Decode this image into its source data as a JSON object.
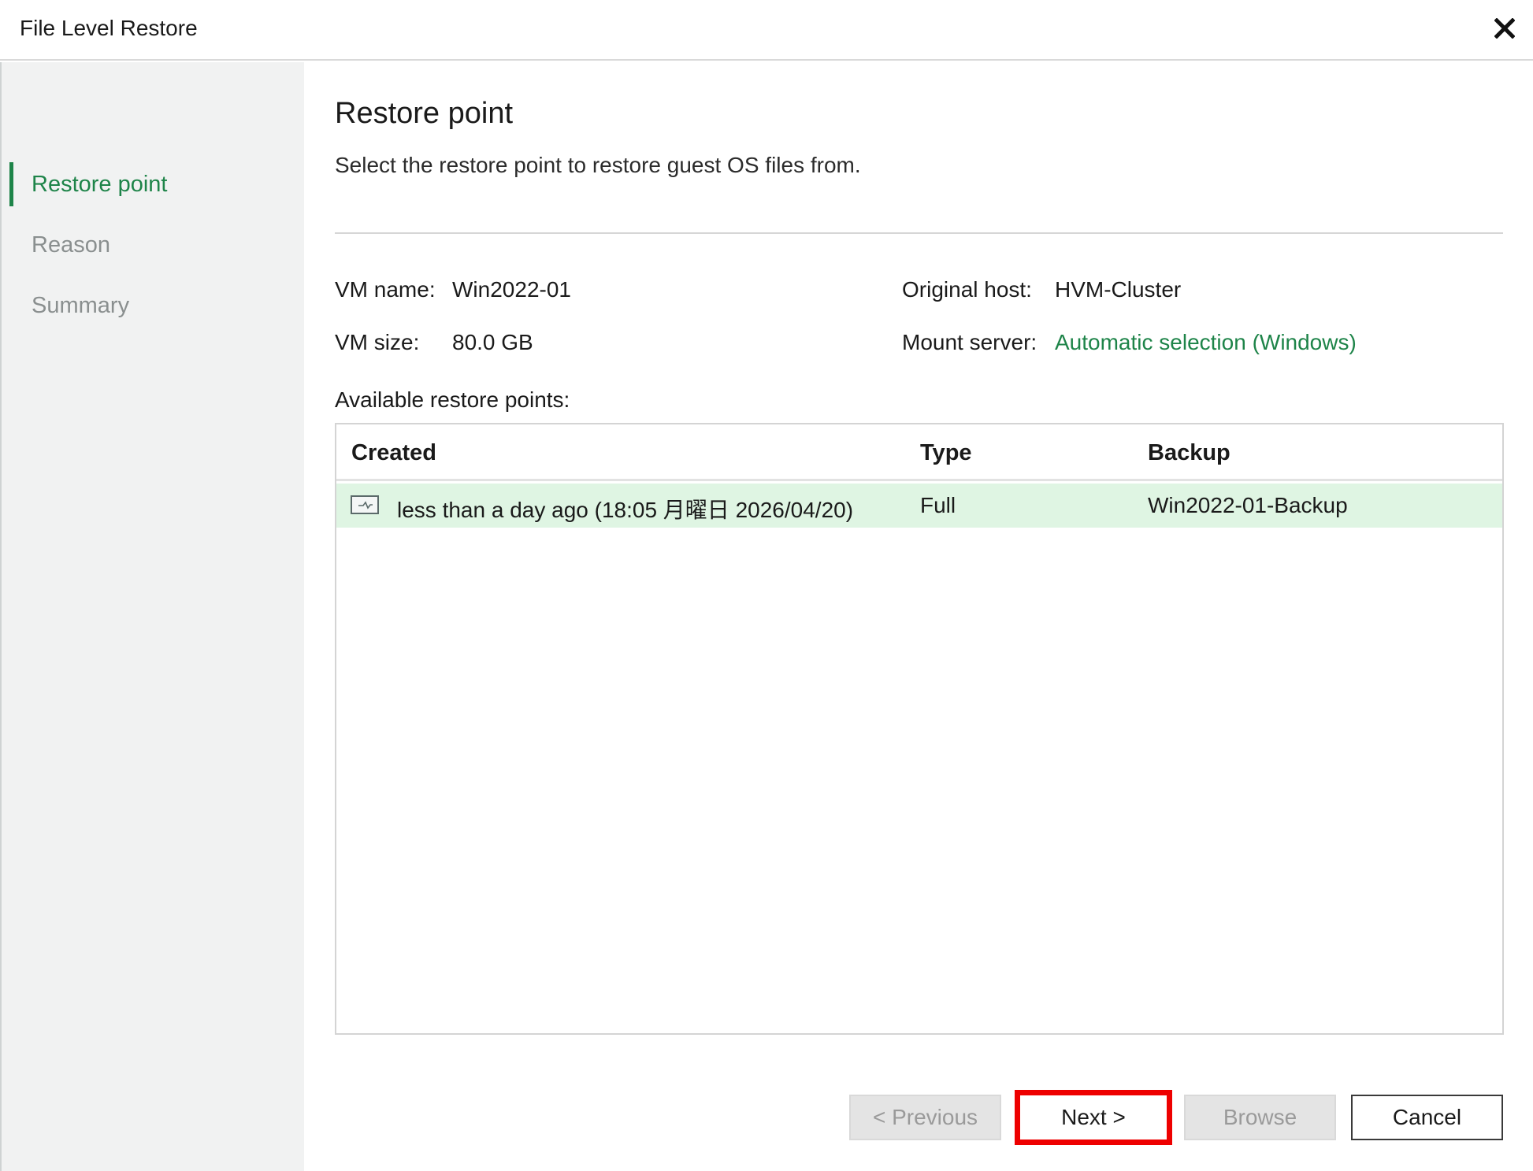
{
  "window": {
    "title": "File Level Restore"
  },
  "sidebar": {
    "steps": [
      {
        "label": "Restore point"
      },
      {
        "label": "Reason"
      },
      {
        "label": "Summary"
      }
    ]
  },
  "page": {
    "title": "Restore point",
    "description": "Select the restore point to restore guest OS files from."
  },
  "info": {
    "vm_name_label": "VM name:",
    "vm_name": "Win2022-01",
    "vm_size_label": "VM size:",
    "vm_size": "80.0 GB",
    "original_host_label": "Original host:",
    "original_host": "HVM-Cluster",
    "mount_server_label": "Mount server:",
    "mount_server": "Automatic selection (Windows)"
  },
  "restore_points": {
    "label": "Available restore points:",
    "columns": [
      "Created",
      "Type",
      "Backup"
    ],
    "rows": [
      {
        "created": "less than a day ago (18:05 月曜日 2026/04/20)",
        "type": "Full",
        "backup": "Win2022-01-Backup"
      }
    ]
  },
  "buttons": {
    "previous": "< Previous",
    "next": "Next >",
    "browse": "Browse",
    "cancel": "Cancel"
  },
  "colors": {
    "accent": "#1e8449",
    "selection": "#dff5e3",
    "highlight": "#ee0000"
  }
}
